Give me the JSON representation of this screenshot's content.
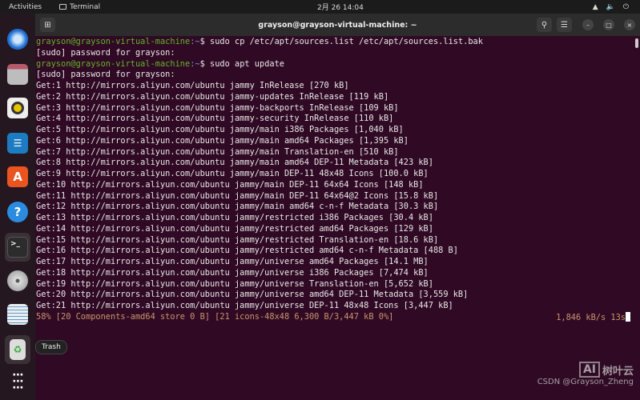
{
  "topbar": {
    "activities": "Activities",
    "app": "Terminal",
    "clock": "2月 26 14:04"
  },
  "dock": {
    "items": [
      "thunderbird",
      "files",
      "rhythmbox",
      "libreoffice-writer",
      "app-center",
      "help",
      "terminal",
      "disc",
      "text-editor",
      "trash",
      "show-apps"
    ],
    "trash_tooltip": "Trash"
  },
  "window": {
    "title": "grayson@grayson-virtual-machine: ~"
  },
  "terminal": {
    "prompt_user": "grayson@grayson-virtual-machine",
    "prompt_path": ":~",
    "prompt_sym": "$ ",
    "cmd1": "sudo cp /etc/apt/sources.list /etc/apt/sources.list.bak",
    "sudo1": "[sudo] password for grayson:",
    "cmd2": "sudo apt update",
    "sudo2": "[sudo] password for grayson:",
    "lines": [
      "Get:1 http://mirrors.aliyun.com/ubuntu jammy InRelease [270 kB]",
      "Get:2 http://mirrors.aliyun.com/ubuntu jammy-updates InRelease [119 kB]",
      "Get:3 http://mirrors.aliyun.com/ubuntu jammy-backports InRelease [109 kB]",
      "Get:4 http://mirrors.aliyun.com/ubuntu jammy-security InRelease [110 kB]",
      "Get:5 http://mirrors.aliyun.com/ubuntu jammy/main i386 Packages [1,040 kB]",
      "Get:6 http://mirrors.aliyun.com/ubuntu jammy/main amd64 Packages [1,395 kB]",
      "Get:7 http://mirrors.aliyun.com/ubuntu jammy/main Translation-en [510 kB]",
      "Get:8 http://mirrors.aliyun.com/ubuntu jammy/main amd64 DEP-11 Metadata [423 kB]",
      "Get:9 http://mirrors.aliyun.com/ubuntu jammy/main DEP-11 48x48 Icons [100.0 kB]",
      "Get:10 http://mirrors.aliyun.com/ubuntu jammy/main DEP-11 64x64 Icons [148 kB]",
      "Get:11 http://mirrors.aliyun.com/ubuntu jammy/main DEP-11 64x64@2 Icons [15.8 kB]",
      "Get:12 http://mirrors.aliyun.com/ubuntu jammy/main amd64 c-n-f Metadata [30.3 kB]",
      "Get:13 http://mirrors.aliyun.com/ubuntu jammy/restricted i386 Packages [30.4 kB]",
      "Get:14 http://mirrors.aliyun.com/ubuntu jammy/restricted amd64 Packages [129 kB]",
      "Get:15 http://mirrors.aliyun.com/ubuntu jammy/restricted Translation-en [18.6 kB]",
      "Get:16 http://mirrors.aliyun.com/ubuntu jammy/restricted amd64 c-n-f Metadata [488 B]",
      "Get:17 http://mirrors.aliyun.com/ubuntu jammy/universe amd64 Packages [14.1 MB]",
      "Get:18 http://mirrors.aliyun.com/ubuntu jammy/universe i386 Packages [7,474 kB]",
      "Get:19 http://mirrors.aliyun.com/ubuntu jammy/universe Translation-en [5,652 kB]",
      "Get:20 http://mirrors.aliyun.com/ubuntu jammy/universe amd64 DEP-11 Metadata [3,559 kB]",
      "Get:21 http://mirrors.aliyun.com/ubuntu jammy/universe DEP-11 48x48 Icons [3,447 kB]"
    ],
    "progress": "58% [20 Components-amd64 store 0 B] [21 icons-48x48 6,300 B/3,447 kB 0%]",
    "progress_percent": 58,
    "rate": "1,846 kB/s 13s"
  },
  "watermark": {
    "brand": "树叶云",
    "logo": "AI",
    "credit": "CSDN @Grayson_Zheng"
  }
}
